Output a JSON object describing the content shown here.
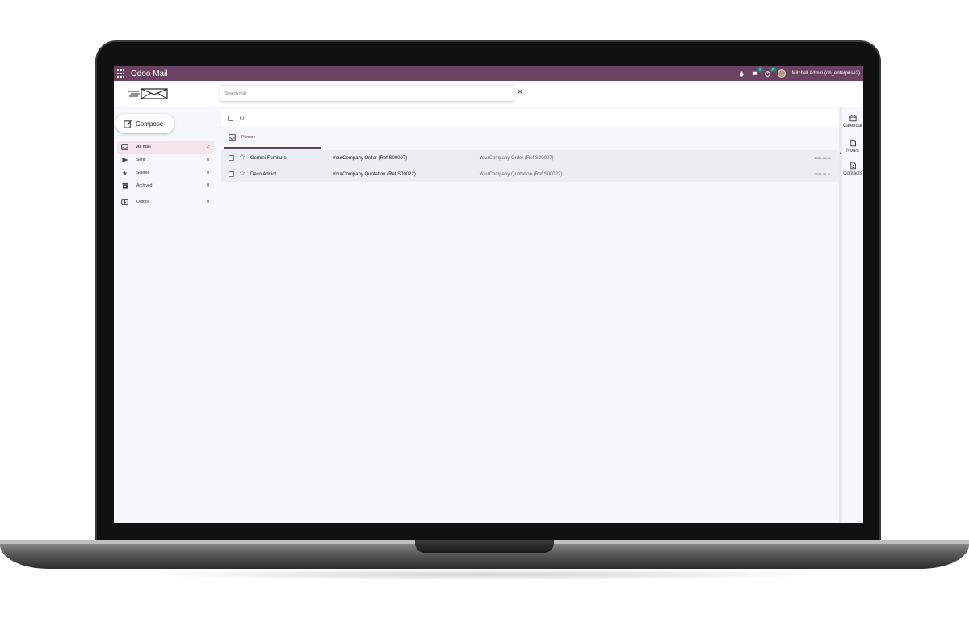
{
  "topbar": {
    "app_title": "Odoo Mail",
    "messages_badge": "5",
    "activities_badge": "2",
    "user": "Mitchell Admin (db_enterprise2)"
  },
  "search": {
    "placeholder": "Search mail"
  },
  "sidebar": {
    "compose_label": "Compose",
    "items": [
      {
        "label": "All mail",
        "count": "2",
        "icon": "inbox-icon"
      },
      {
        "label": "Sent",
        "count": "0",
        "icon": "send-icon"
      },
      {
        "label": "Starred",
        "count": "0",
        "icon": "star-icon"
      },
      {
        "label": "Archived",
        "count": "0",
        "icon": "archive-icon"
      },
      {
        "label": "Outbox",
        "count": "0",
        "icon": "outbox-icon"
      }
    ]
  },
  "tabs": [
    {
      "label": "Primary"
    }
  ],
  "mails": [
    {
      "from": "Gemini Furniture",
      "subject": "YourCompany Order (Ref S00007)",
      "preview": "YourCompany Order (Ref S00007)",
      "date": "2023-05-31"
    },
    {
      "from": "Deco Addict",
      "subject": "YourCompany Quotation (Ref S00022)",
      "preview": "YourCompany Quotation (Ref S00022)",
      "date": "2023-05-31"
    }
  ],
  "rightbar": {
    "items": [
      {
        "label": "Calendar",
        "icon": "calendar-icon"
      },
      {
        "label": "Notes",
        "icon": "notes-icon"
      },
      {
        "label": "Contacts",
        "icon": "contacts-icon"
      }
    ]
  },
  "colors": {
    "brand": "#6b4262",
    "active_bg": "#f4e5ea",
    "badge": "#1f8a82"
  }
}
